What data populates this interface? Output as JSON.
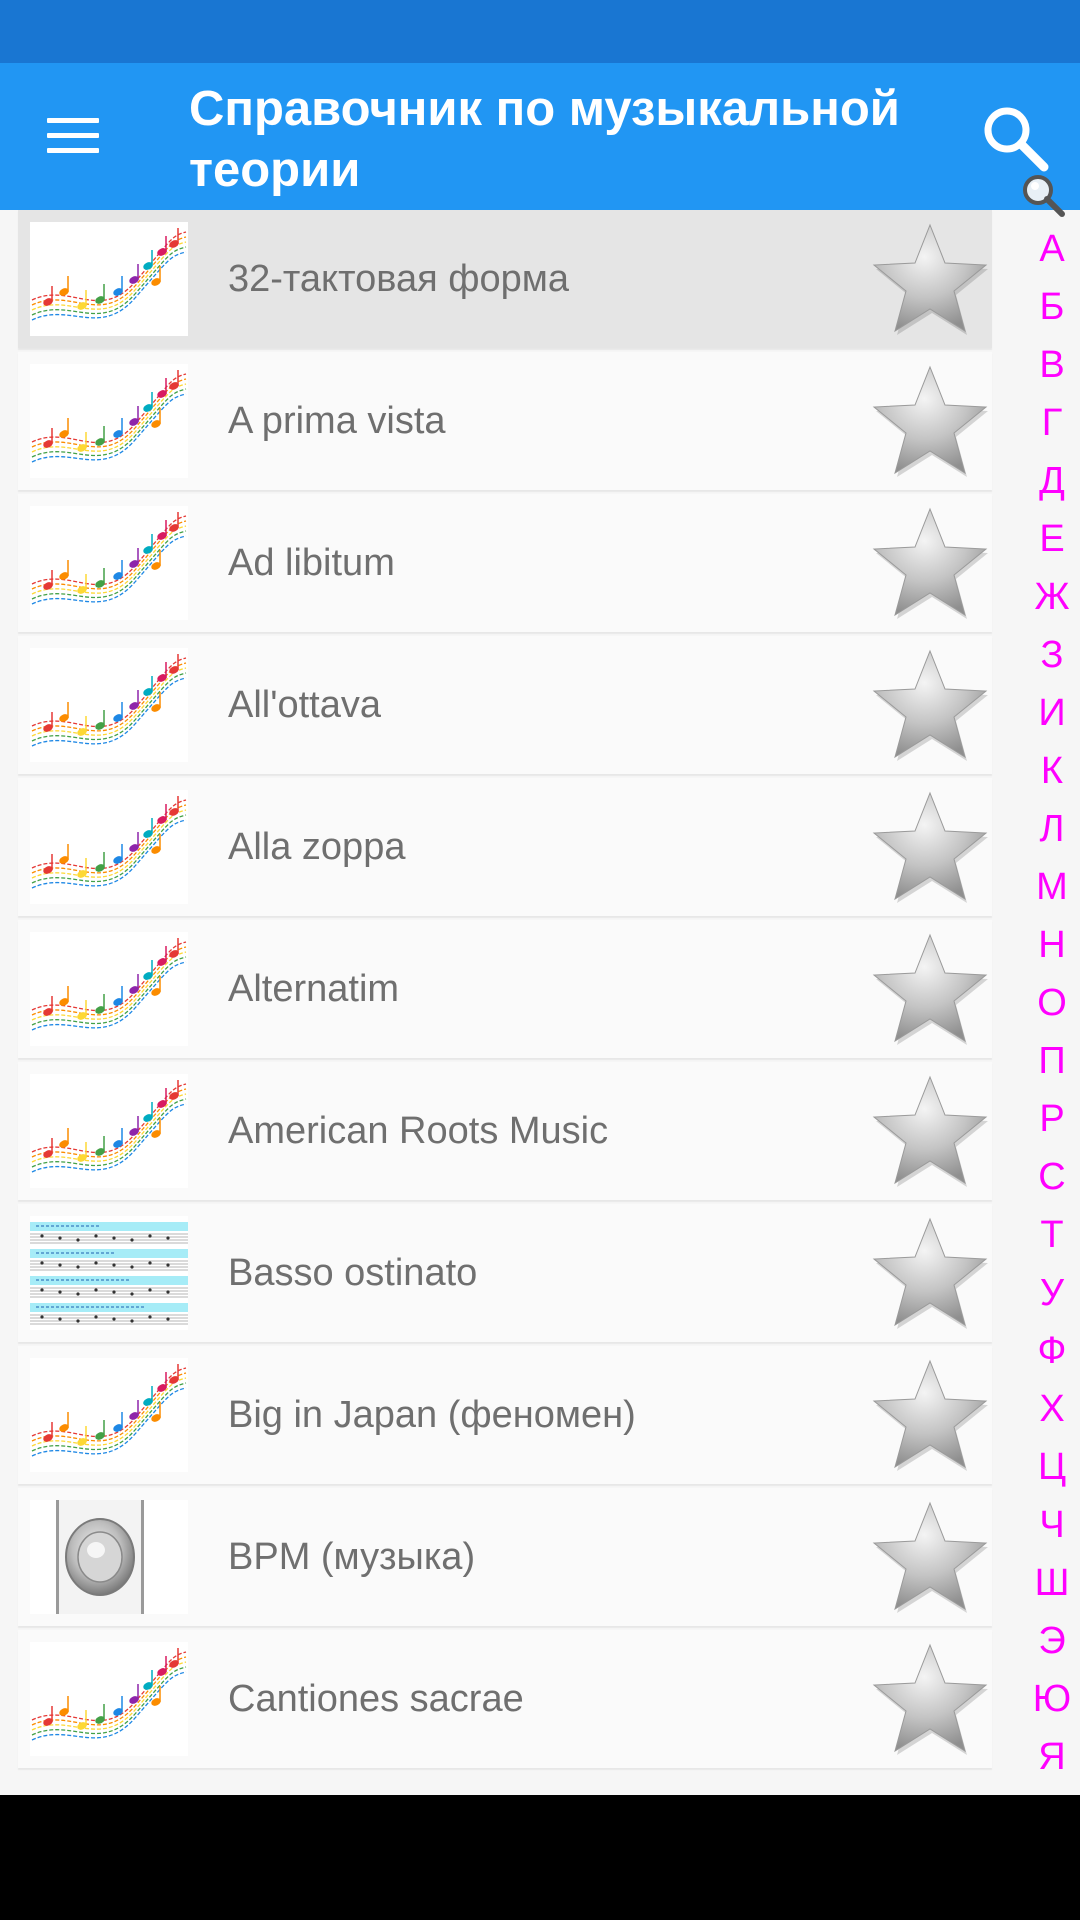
{
  "app_bar": {
    "title": "Справочник по музыкальной теории",
    "menu_icon": "hamburger-menu-icon",
    "search_icon": "search-icon",
    "color": "#2196f3",
    "status_color": "#1976d2"
  },
  "list": {
    "items": [
      {
        "label": "32-тактовая форма",
        "thumb": "music-notes",
        "selected": true
      },
      {
        "label": "A prima vista",
        "thumb": "music-notes"
      },
      {
        "label": "Ad libitum",
        "thumb": "music-notes"
      },
      {
        "label": "All'ottava",
        "thumb": "music-notes"
      },
      {
        "label": "Alla zoppa",
        "thumb": "music-notes"
      },
      {
        "label": "Alternatim",
        "thumb": "music-notes"
      },
      {
        "label": "American Roots Music",
        "thumb": "music-notes"
      },
      {
        "label": "Basso ostinato",
        "thumb": "sheet-music"
      },
      {
        "label": "Big in Japan (феномен)",
        "thumb": "music-notes"
      },
      {
        "label": "BPM (музыка)",
        "thumb": "speaker"
      },
      {
        "label": "Cantiones sacrae",
        "thumb": "music-notes"
      }
    ],
    "favorite_icon": "star-icon"
  },
  "alphabet_index": {
    "search_icon": "search-icon",
    "color": "#ff00ff",
    "letters": [
      "А",
      "Б",
      "В",
      "Г",
      "Д",
      "Е",
      "Ж",
      "З",
      "И",
      "К",
      "Л",
      "М",
      "Н",
      "О",
      "П",
      "Р",
      "С",
      "Т",
      "У",
      "Ф",
      "Х",
      "Ц",
      "Ч",
      "Ш",
      "Э",
      "Ю",
      "Я"
    ]
  }
}
